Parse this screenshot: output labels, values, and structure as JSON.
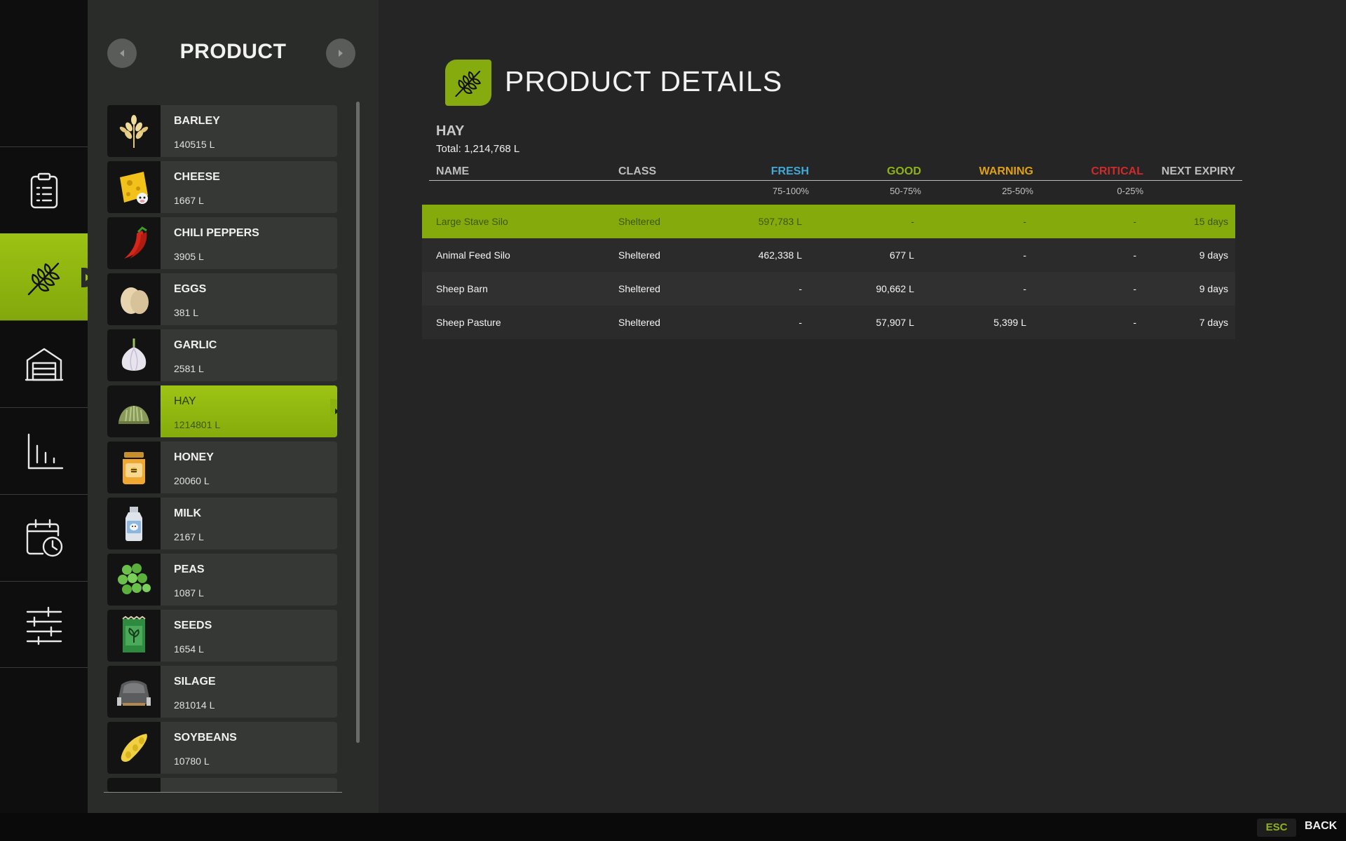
{
  "nav": {
    "items": [
      {
        "id": "tasks",
        "icon": "clipboard-list-icon"
      },
      {
        "id": "products",
        "icon": "wheat-icon",
        "active": true
      },
      {
        "id": "storage",
        "icon": "barn-icon"
      },
      {
        "id": "statistics",
        "icon": "bar-chart-icon"
      },
      {
        "id": "schedule",
        "icon": "calendar-clock-icon"
      },
      {
        "id": "settings",
        "icon": "sliders-icon"
      }
    ]
  },
  "product_list": {
    "title": "PRODUCT",
    "items": [
      {
        "name": "BARLEY",
        "qty": "140515 L",
        "icon": "barley-icon"
      },
      {
        "name": "CHEESE",
        "qty": "1667 L",
        "icon": "cheese-icon"
      },
      {
        "name": "CHILI PEPPERS",
        "qty": "3905 L",
        "icon": "chili-pepper-icon"
      },
      {
        "name": "EGGS",
        "qty": "381 L",
        "icon": "eggs-icon"
      },
      {
        "name": "GARLIC",
        "qty": "2581 L",
        "icon": "garlic-icon"
      },
      {
        "name": "HAY",
        "qty": "1214801 L",
        "icon": "hay-icon",
        "selected": true
      },
      {
        "name": "HONEY",
        "qty": "20060 L",
        "icon": "honey-jar-icon"
      },
      {
        "name": "MILK",
        "qty": "2167 L",
        "icon": "milk-can-icon"
      },
      {
        "name": "PEAS",
        "qty": "1087 L",
        "icon": "peas-icon"
      },
      {
        "name": "SEEDS",
        "qty": "1654 L",
        "icon": "seed-bag-icon"
      },
      {
        "name": "SILAGE",
        "qty": "281014 L",
        "icon": "silage-icon"
      },
      {
        "name": "SOYBEANS",
        "qty": "10780 L",
        "icon": "soybeans-icon"
      }
    ]
  },
  "details": {
    "title": "PRODUCT DETAILS",
    "product_name": "HAY",
    "total": "Total: 1,214,768 L",
    "columns": {
      "name": "NAME",
      "class": "CLASS",
      "fresh": "FRESH",
      "good": "GOOD",
      "warning": "WARNING",
      "critical": "CRITICAL",
      "next_expiry": "NEXT EXPIRY"
    },
    "ranges": {
      "fresh": "75-100%",
      "good": "50-75%",
      "warning": "25-50%",
      "critical": "0-25%"
    },
    "rows": [
      {
        "name": "Large Stave Silo",
        "class": "Sheltered",
        "fresh": "597,783 L",
        "good": "-",
        "warning": "-",
        "critical": "-",
        "next_expiry": "15 days"
      },
      {
        "name": "Animal Feed Silo",
        "class": "Sheltered",
        "fresh": "462,338 L",
        "good": "677 L",
        "warning": "-",
        "critical": "-",
        "next_expiry": "9 days"
      },
      {
        "name": "Sheep Barn",
        "class": "Sheltered",
        "fresh": "-",
        "good": "90,662 L",
        "warning": "-",
        "critical": "-",
        "next_expiry": "9 days"
      },
      {
        "name": "Sheep Pasture",
        "class": "Sheltered",
        "fresh": "-",
        "good": "57,907 L",
        "warning": "5,399 L",
        "critical": "-",
        "next_expiry": "7 days"
      }
    ]
  },
  "footer": {
    "esc_key": "ESC",
    "back_label": "BACK"
  },
  "colors": {
    "accent": "#8fb313",
    "fresh": "#3fa9d8",
    "good": "#8fb313",
    "warning": "#e0a014",
    "critical": "#d02a2a"
  }
}
